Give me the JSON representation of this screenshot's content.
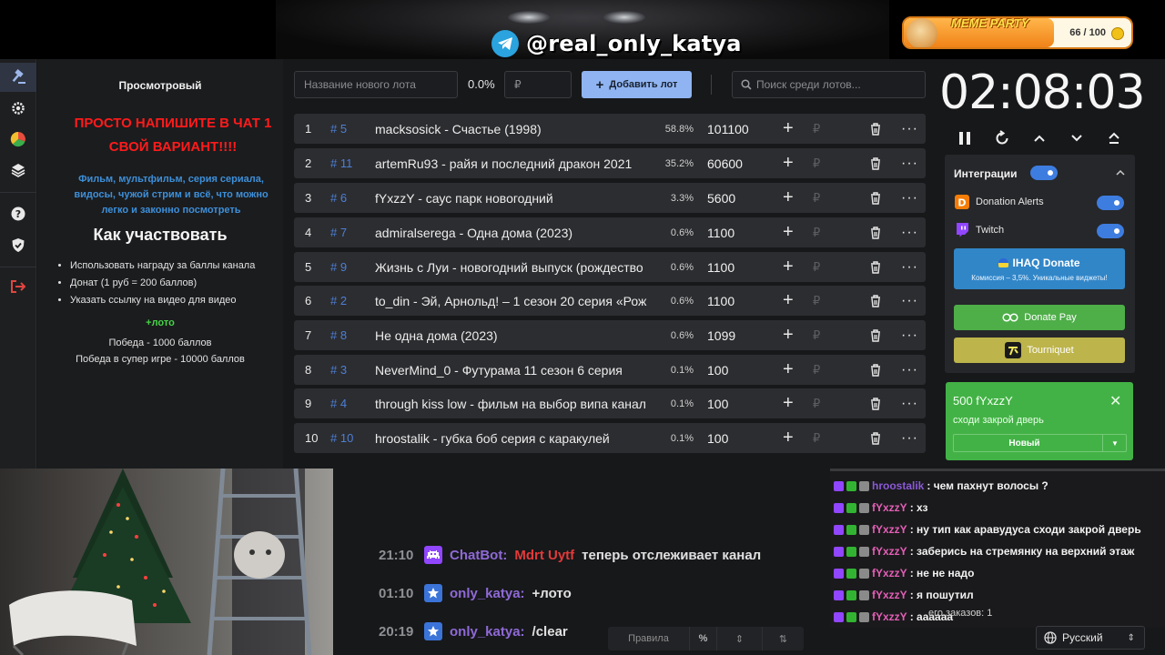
{
  "banner": {
    "telegram_handle": "@real_only_katya",
    "meme_party": {
      "title": "MEME PARTY",
      "count": "66 / 100",
      "progress": 0.66
    }
  },
  "sidebar": {
    "items": [
      {
        "icon": "gavel-icon"
      },
      {
        "icon": "gear-icon"
      },
      {
        "icon": "wheel-icon"
      },
      {
        "icon": "layers-icon"
      },
      {
        "icon": "help-icon"
      },
      {
        "icon": "shield-icon"
      },
      {
        "icon": "logout-icon"
      }
    ]
  },
  "info": {
    "title": "Просмотровый",
    "cta": "ПРОСТО НАПИШИТЕ В ЧАТ 1 СВОЙ ВАРИАНТ!!!!",
    "types": "Фильм, мультфильм, серия сериала, видосы, чужой стрим и всё, что можно легко и законно посмотреть",
    "how_title": "Как участвовать",
    "rules": [
      "Использовать награду за баллы канала",
      "Донат (1 руб = 200 баллов)",
      "Указать ссылку на видео для видео"
    ],
    "loto": "+лото",
    "win": "Победа - 1000 баллов",
    "win_super": "Победа в супер игре - 10000 баллов"
  },
  "toolbar": {
    "new_lot_placeholder": "Название нового лота",
    "percent": "0.0%",
    "amount_placeholder": "₽",
    "add_lot_label": "Добавить лот",
    "search_placeholder": "Поиск среди лотов..."
  },
  "lots": [
    {
      "rank": "1",
      "id": "# 5",
      "name": "macksosick - Счастье (1998)",
      "pct": "58.8%",
      "amount": "101100"
    },
    {
      "rank": "2",
      "id": "# 11",
      "name": "artemRu93 - райя и последний дракон 2021",
      "pct": "35.2%",
      "amount": "60600"
    },
    {
      "rank": "3",
      "id": "# 6",
      "name": "fYxzzY  - саус парк новогодний",
      "pct": "3.3%",
      "amount": "5600"
    },
    {
      "rank": "4",
      "id": "# 7",
      "name": "admiralserega - Одна дома (2023)",
      "pct": "0.6%",
      "amount": "1100"
    },
    {
      "rank": "5",
      "id": "# 9",
      "name": "Жизнь с Луи - новогодний выпуск (рождество",
      "pct": "0.6%",
      "amount": "1100"
    },
    {
      "rank": "6",
      "id": "# 2",
      "name": "to_din - Эй, Арнольд! – 1 сезон 20 серия «Рож",
      "pct": "0.6%",
      "amount": "1100"
    },
    {
      "rank": "7",
      "id": "# 8",
      "name": "Не одна дома (2023)",
      "pct": "0.6%",
      "amount": "1099"
    },
    {
      "rank": "8",
      "id": "# 3",
      "name": "NeverMind_0 - Футурама 11 сезон 6 серия",
      "pct": "0.1%",
      "amount": "100"
    },
    {
      "rank": "9",
      "id": "# 4",
      "name": " through kiss low - фильм на выбор випа канал",
      "pct": "0.1%",
      "amount": "100"
    },
    {
      "rank": "10",
      "id": "# 10",
      "name": " hroostalik - губка боб серия с каракулей",
      "pct": "0.1%",
      "amount": "100"
    }
  ],
  "lot_row_symbols": {
    "plus": "+",
    "currency": "₽",
    "more": "···"
  },
  "timer": {
    "value": "02:08:03"
  },
  "integrations": {
    "title": "Интеграции",
    "donation_alerts": "Donation Alerts",
    "twitch": "Twitch",
    "ihaq_title": "IHAQ Donate",
    "ihaq_sub": "Комиссия – 3,5%. Уникальные виджеты!",
    "donate_pay": "Donate Pay",
    "tourniquet": "Tourniquet"
  },
  "order_card": {
    "title": "500 fYxzzY",
    "message": "сходи закрой дверь",
    "status": "Новый",
    "close": "✕"
  },
  "overlay_chat": [
    {
      "time": "21:10",
      "user": "ChatBot:",
      "mention": "Mdrt Uytf",
      "text": "теперь отслеживает канал",
      "icon": "space-invader-icon"
    },
    {
      "time": "01:10",
      "user": "only_katya:",
      "text": "+лото",
      "icon": "star-icon"
    },
    {
      "time": "20:19",
      "user": "only_katya:",
      "text": "/clear",
      "icon": "star-icon"
    }
  ],
  "bottom_toolbar": {
    "rules": "Правила",
    "percent": "%"
  },
  "twitch_chat": [
    {
      "user": "hroostalik",
      "text": ": чем пахнут волосы ?",
      "color": "#8a59d6"
    },
    {
      "user": "fYxzzY",
      "text": ": хз",
      "color": "#e45fb6"
    },
    {
      "user": "fYxzzY",
      "text": ": ну тип как аравудуса сходи закрой дверь",
      "color": "#e45fb6"
    },
    {
      "user": "fYxzzY",
      "text": ": заберись на стремянку на верхний этаж",
      "color": "#e45fb6"
    },
    {
      "user": "fYxzzY",
      "text": ": не не надо",
      "color": "#e45fb6"
    },
    {
      "user": "fYxzzY",
      "text": ": я пошутил",
      "color": "#e45fb6"
    },
    {
      "user": "fYxzzY",
      "text": ": аааааа",
      "color": "#e45fb6"
    }
  ],
  "orders_count": "его заказов:  1",
  "language": {
    "selected": "Русский"
  }
}
